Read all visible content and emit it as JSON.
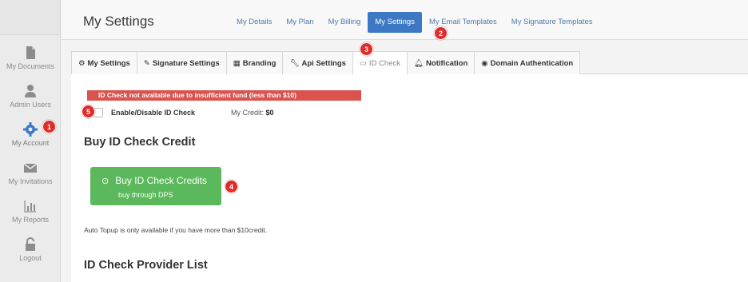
{
  "sidebar": {
    "items": [
      {
        "label": "My Documents",
        "icon": "document-icon"
      },
      {
        "label": "Admin Users",
        "icon": "user-icon"
      },
      {
        "label": "My Account",
        "icon": "gear-icon"
      },
      {
        "label": "My Invitations",
        "icon": "envelope-icon"
      },
      {
        "label": "My Reports",
        "icon": "bar-chart-icon"
      },
      {
        "label": "Logout",
        "icon": "unlock-icon"
      }
    ]
  },
  "header": {
    "title": "My Settings",
    "nav": [
      {
        "label": "My Details"
      },
      {
        "label": "My Plan"
      },
      {
        "label": "My Billing"
      },
      {
        "label": "My Settings"
      },
      {
        "label": "My Email Templates"
      },
      {
        "label": "My Signature Templates"
      }
    ]
  },
  "tabs": [
    {
      "label": "My Settings",
      "icon": "gear-icon"
    },
    {
      "label": "Signature Settings",
      "icon": "pencil-icon"
    },
    {
      "label": "Branding",
      "icon": "grid-icon"
    },
    {
      "label": "Api Settings",
      "icon": "wrench-icon"
    },
    {
      "label": "ID Check",
      "icon": "id-card-icon"
    },
    {
      "label": "Notification",
      "icon": "bell-icon"
    },
    {
      "label": "Domain Authentication",
      "icon": "globe-icon"
    }
  ],
  "idcheck": {
    "alert": "ID Check not available due to insufficient fund (less than $10)",
    "toggle_label": "Enable/Disable ID Check",
    "credit_label": "My Credit:",
    "credit_value": "$0",
    "buy_heading": "Buy ID Check Credit",
    "buy_button_title": "Buy ID Check Credits",
    "buy_button_sub": "buy through DPS",
    "topup_note": "Auto Topup is only available if you have more than $10credit.",
    "provider_heading": "ID Check Provider List"
  },
  "markers": [
    "1",
    "2",
    "3",
    "4",
    "5"
  ],
  "colors": {
    "active_nav": "#3c78c4",
    "alert": "#d9534f",
    "buy_button": "#5cb85c",
    "marker": "#e02b2b"
  }
}
